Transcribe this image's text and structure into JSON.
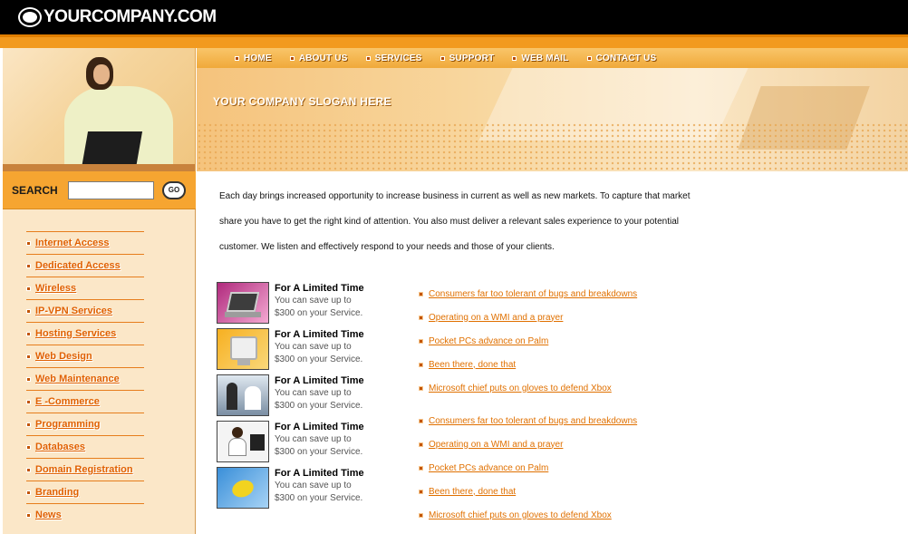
{
  "header": {
    "logo_text": "YOURCOMPANY.COM"
  },
  "nav": {
    "items": [
      {
        "label": "HOME"
      },
      {
        "label": "ABOUT US"
      },
      {
        "label": "SERVICES"
      },
      {
        "label": "SUPPORT"
      },
      {
        "label": "WEB MAIL"
      },
      {
        "label": "CONTACT US"
      }
    ]
  },
  "banner": {
    "slogan": "YOUR COMPANY SLOGAN HERE"
  },
  "search": {
    "label": "SEARCH",
    "value": "",
    "button_label": "GO"
  },
  "sidebar": {
    "items": [
      {
        "label": "Internet Access"
      },
      {
        "label": "Dedicated Access"
      },
      {
        "label": "Wireless"
      },
      {
        "label": "IP-VPN Services"
      },
      {
        "label": "Hosting Services"
      },
      {
        "label": "Web Design"
      },
      {
        "label": "Web Maintenance"
      },
      {
        "label": "E -Commerce"
      },
      {
        "label": "Programming"
      },
      {
        "label": "Databases"
      },
      {
        "label": "Domain Registration"
      },
      {
        "label": "Branding"
      },
      {
        "label": "News"
      }
    ]
  },
  "main": {
    "intro": "Each day brings increased opportunity to increase business in current as well as new markets. To capture that market share you have to get the right kind of attention. You also must deliver a relevant sales experience to your potential customer. We listen and effectively respond to your needs and those of your clients.",
    "promos": [
      {
        "heading": "For A Limited Time",
        "line1": "You can save up to",
        "line2": "$300 on your Service.",
        "icon": "laptop-icon"
      },
      {
        "heading": "For A Limited Time",
        "line1": "You can save up to",
        "line2": "$300 on your Service.",
        "icon": "monitor-icon"
      },
      {
        "heading": "For A Limited Time",
        "line1": "You can save up to",
        "line2": "$300 on your Service.",
        "icon": "office-people-icon"
      },
      {
        "heading": "For A Limited Time",
        "line1": "You can save up to",
        "line2": "$300 on your Service.",
        "icon": "woman-computer-icon"
      },
      {
        "heading": "For A Limited Time",
        "line1": "You can save up to",
        "line2": "$300 on your Service.",
        "icon": "mouse-icon"
      }
    ],
    "news": [
      {
        "label": "Consumers far too tolerant of bugs and breakdowns"
      },
      {
        "label": "Operating on a WMI and a prayer"
      },
      {
        "label": "Pocket PCs advance on Palm"
      },
      {
        "label": "Been there, done that"
      },
      {
        "label": "Microsoft chief puts on gloves to defend Xbox"
      },
      {
        "label": "Consumers far too tolerant of bugs and breakdowns"
      },
      {
        "label": "Operating on a WMI and a prayer"
      },
      {
        "label": "Pocket PCs advance on Palm"
      },
      {
        "label": "Been there, done that"
      },
      {
        "label": "Microsoft chief puts on gloves to defend Xbox"
      }
    ]
  },
  "colors": {
    "accent": "#f29a1f",
    "link": "#e07000",
    "sidebar_bg": "#fbe7c8",
    "header_bg": "#000000"
  }
}
